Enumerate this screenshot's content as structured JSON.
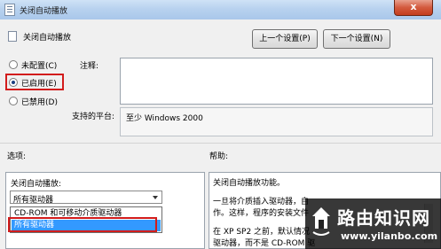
{
  "window": {
    "title": "关闭自动播放",
    "close_symbol": "x"
  },
  "header": {
    "setting_name": "关闭自动播放",
    "prev_button": "上一个设置(P)",
    "next_button": "下一个设置(N)"
  },
  "state": {
    "options": [
      {
        "label": "未配置(C)",
        "checked": false
      },
      {
        "label": "已启用(E)",
        "checked": true
      },
      {
        "label": "已禁用(D)",
        "checked": false
      }
    ]
  },
  "comment": {
    "label": "注释:",
    "value": ""
  },
  "platform": {
    "label": "支持的平台:",
    "value": "至少 Windows 2000"
  },
  "options_section": {
    "label": "选项:",
    "field_label": "关闭自动播放:",
    "selected_value": "所有驱动器",
    "dropdown_items": [
      "CD-ROM 和可移动介质驱动器",
      "所有驱动器"
    ],
    "highlighted_index": 1
  },
  "help_section": {
    "label": "帮助:",
    "lines": [
      "关闭自动播放功能。",
      "一旦将介质插入驱动器，自",
      "作。这样，程序的安装文件",
      "在 XP SP2 之前，默认情况",
      "驱动器，而不是 CD-ROM 驱"
    ]
  },
  "watermark": {
    "title": "路由知识网",
    "url": "www.yilanbo.com"
  },
  "colors": {
    "highlight_red": "#d21c1c",
    "selection_blue": "#3399ff",
    "titlebar_blue": "#b8d2ef",
    "close_red": "#c43d1e"
  },
  "icons": [
    "app-icon",
    "setting-doc-icon",
    "close-icon",
    "chevron-down-icon",
    "house-logo-icon"
  ]
}
